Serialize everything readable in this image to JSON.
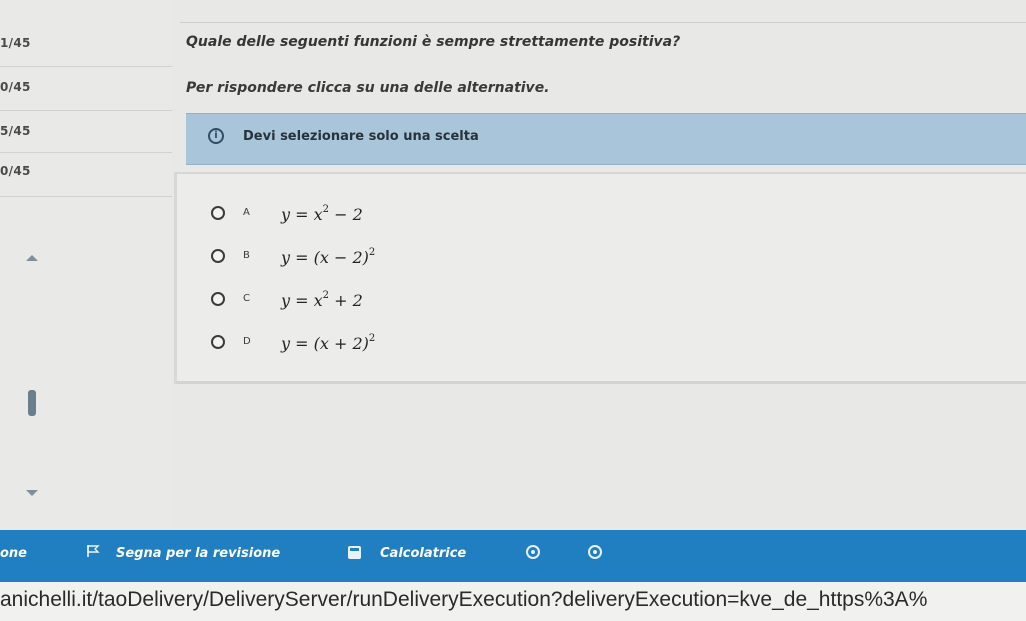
{
  "sidebar": {
    "items": [
      {
        "label": "1/45"
      },
      {
        "label": "0/45"
      },
      {
        "label": "5/45"
      },
      {
        "label": "0/45"
      }
    ]
  },
  "question": {
    "text": "Quale delle seguenti funzioni è sempre strettamente positiva?",
    "instruction": "Per rispondere clicca su una delle alternative.",
    "notice": "Devi selezionare solo una scelta"
  },
  "options": [
    {
      "letter": "A",
      "lhs": "y = x",
      "exp": "2",
      "rhs": " − 2"
    },
    {
      "letter": "B",
      "lhs": "y = (x − 2)",
      "exp": "2",
      "rhs": ""
    },
    {
      "letter": "C",
      "lhs": "y = x",
      "exp": "2",
      "rhs": " + 2"
    },
    {
      "letter": "D",
      "lhs": "y = (x + 2)",
      "exp": "2",
      "rhs": ""
    }
  ],
  "toolbar": {
    "left_label": "one",
    "review_label": "Segna per la revisione",
    "calculator_label": "Calcolatrice"
  },
  "address": {
    "url": "anichelli.it/taoDelivery/DeliveryServer/runDeliveryExecution?deliveryExecution=kve_de_https%3A%"
  },
  "colors": {
    "toolbar_bg": "#1f7fc1",
    "notice_bg": "#a9c5da"
  }
}
